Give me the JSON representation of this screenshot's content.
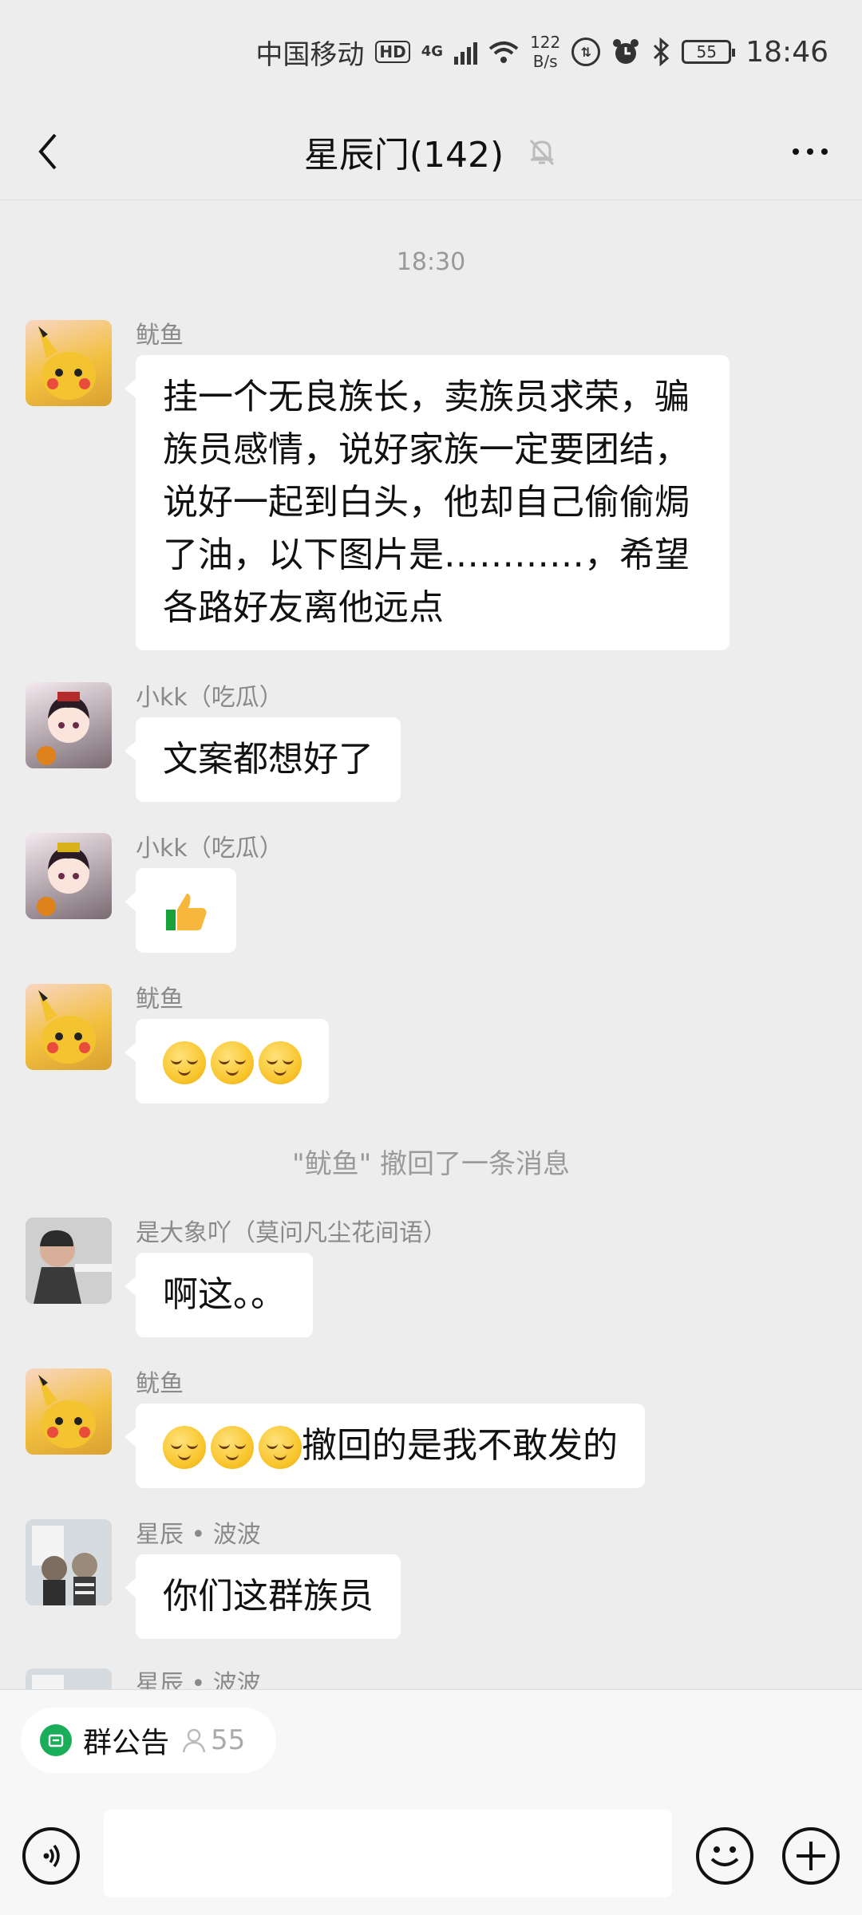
{
  "status_bar": {
    "carrier": "中国移动",
    "hd_label": "HD",
    "network_type": "4G",
    "net_speed_value": "122",
    "net_speed_unit": "B/s",
    "battery": "55",
    "time": "18:46"
  },
  "header": {
    "title": "星辰门(142)",
    "back_icon": "chevron-left-icon",
    "mute_icon": "bell-off-icon",
    "more_icon": "more-icon"
  },
  "chat": {
    "timestamp": "18:30",
    "messages": [
      {
        "sender": "鱿鱼",
        "avatar": "pikachu-avatar",
        "text": "挂一个无良族长，卖族员求荣，骗族员感情，说好家族一定要团结，说好一起到白头，他却自己偷偷焗了油，以下图片是…………，希望各路好友离他远点"
      },
      {
        "sender": "小kk（吃瓜）",
        "avatar": "anime-girl-avatar",
        "text": "文案都想好了"
      },
      {
        "sender": "小kk（吃瓜）",
        "avatar": "anime-girl-avatar",
        "emoji": "thumbs-up"
      },
      {
        "sender": "鱿鱼",
        "avatar": "pikachu-avatar",
        "emoji": "smirk-face x3"
      },
      {
        "sender": "是大象吖（莫问凡尘花间语）",
        "avatar": "baby-avatar",
        "text": "啊这。。"
      },
      {
        "sender": "鱿鱼",
        "avatar": "pikachu-avatar",
        "emoji": "relieved-face x3",
        "text": "撤回的是我不敢发的"
      },
      {
        "sender": "星辰 • 波波",
        "avatar": "cats-avatar",
        "text": "你们这群族员"
      },
      {
        "sender": "星辰 • 波波",
        "avatar": "cats-avatar"
      }
    ],
    "recall_notice": "\"鱿鱼\" 撤回了一条消息"
  },
  "bottom": {
    "notice_label": "群公告",
    "member_count": "55",
    "input_value": "",
    "voice_icon": "voice-icon",
    "emoji_icon": "emoji-icon",
    "plus_icon": "plus-icon"
  }
}
